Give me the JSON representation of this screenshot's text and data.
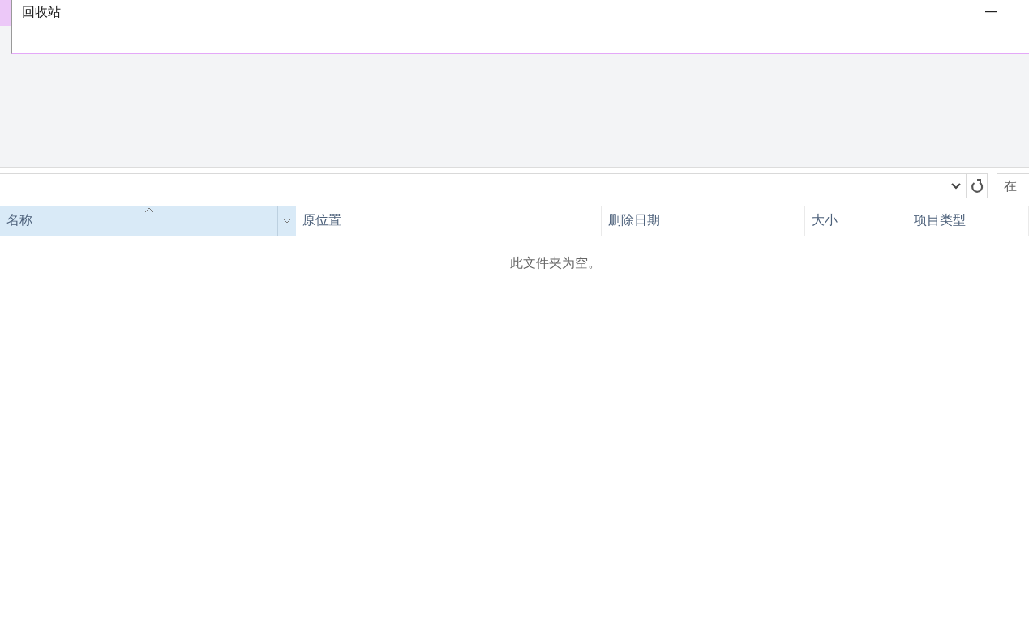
{
  "window": {
    "title": "回收站"
  },
  "search": {
    "placeholder": "在"
  },
  "columns": [
    {
      "label": "名称",
      "selected": true,
      "sorted": true
    },
    {
      "label": "原位置",
      "selected": false,
      "sorted": false
    },
    {
      "label": "删除日期",
      "selected": false,
      "sorted": false
    },
    {
      "label": "大小",
      "selected": false,
      "sorted": false
    },
    {
      "label": "项目类型",
      "selected": false,
      "sorted": false
    }
  ],
  "empty_message": "此文件夹为空。"
}
